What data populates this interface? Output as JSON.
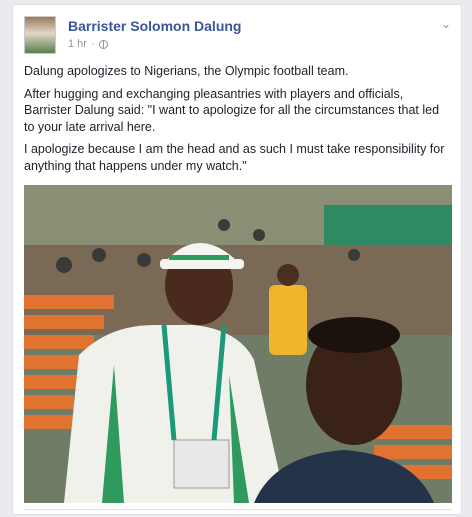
{
  "post": {
    "author": "Barrister Solomon Dalung",
    "time": "1 hr",
    "separator": "·",
    "paragraphs": [
      "Dalung apologizes to Nigerians, the Olympic football team.",
      "After hugging and exchanging pleasantries with players and officials, Barrister Dalung said: \"I want to apologize for all the circumstances that led to your late arrival here.",
      "I apologize because I am the head and as such I must take responsibility for anything that happens under my watch.\""
    ]
  },
  "icons": {
    "privacy": "globe-icon",
    "options": "chevron-down-icon"
  },
  "colors": {
    "author_link": "#365899",
    "meta_text": "#90949c",
    "body_text": "#1d2129"
  }
}
